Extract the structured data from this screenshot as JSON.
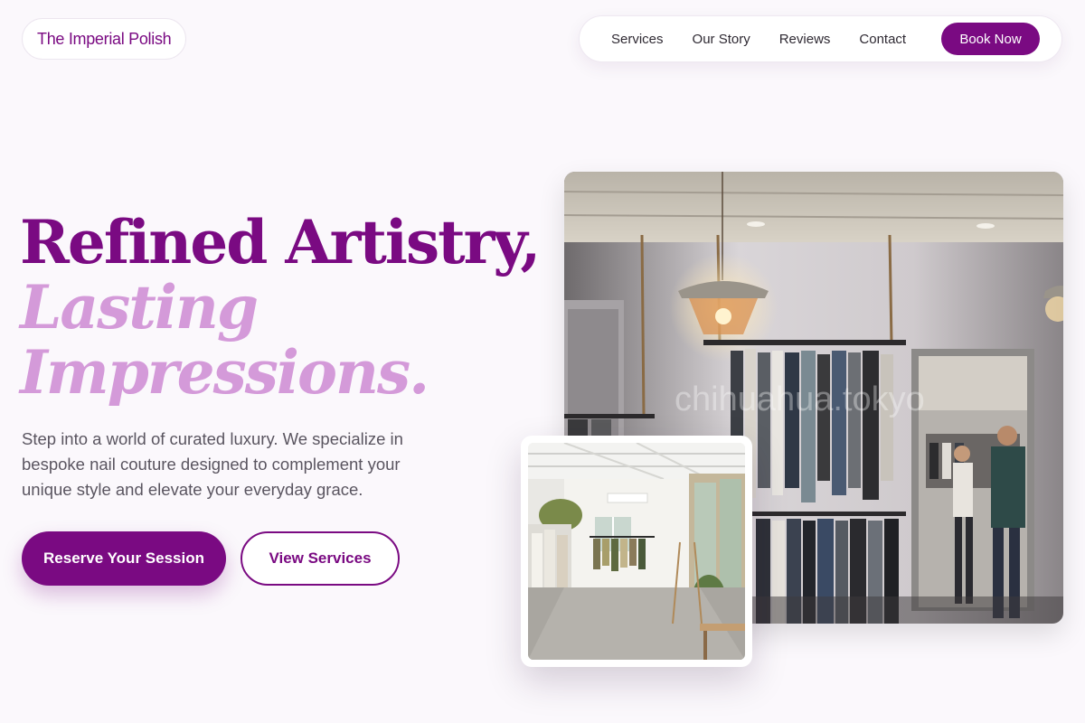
{
  "header": {
    "brand": "The Imperial Polish",
    "nav": [
      "Services",
      "Our Story",
      "Reviews",
      "Contact"
    ],
    "cta": "Book Now"
  },
  "hero": {
    "title_line1": "Refined Artistry,",
    "title_line2": "Lasting",
    "title_line3": "Impressions.",
    "description": "Step into a world of curated luxury. We specialize in bespoke nail couture designed to complement your unique style and elevate your everyday grace.",
    "primary_button": "Reserve Your Session",
    "secondary_button": "View Services"
  },
  "images": {
    "main_watermark": "chihuahua.tokyo"
  },
  "colors": {
    "brand": "#7a0a82",
    "accent": "#d49ad9",
    "background": "#fbf8fc"
  }
}
